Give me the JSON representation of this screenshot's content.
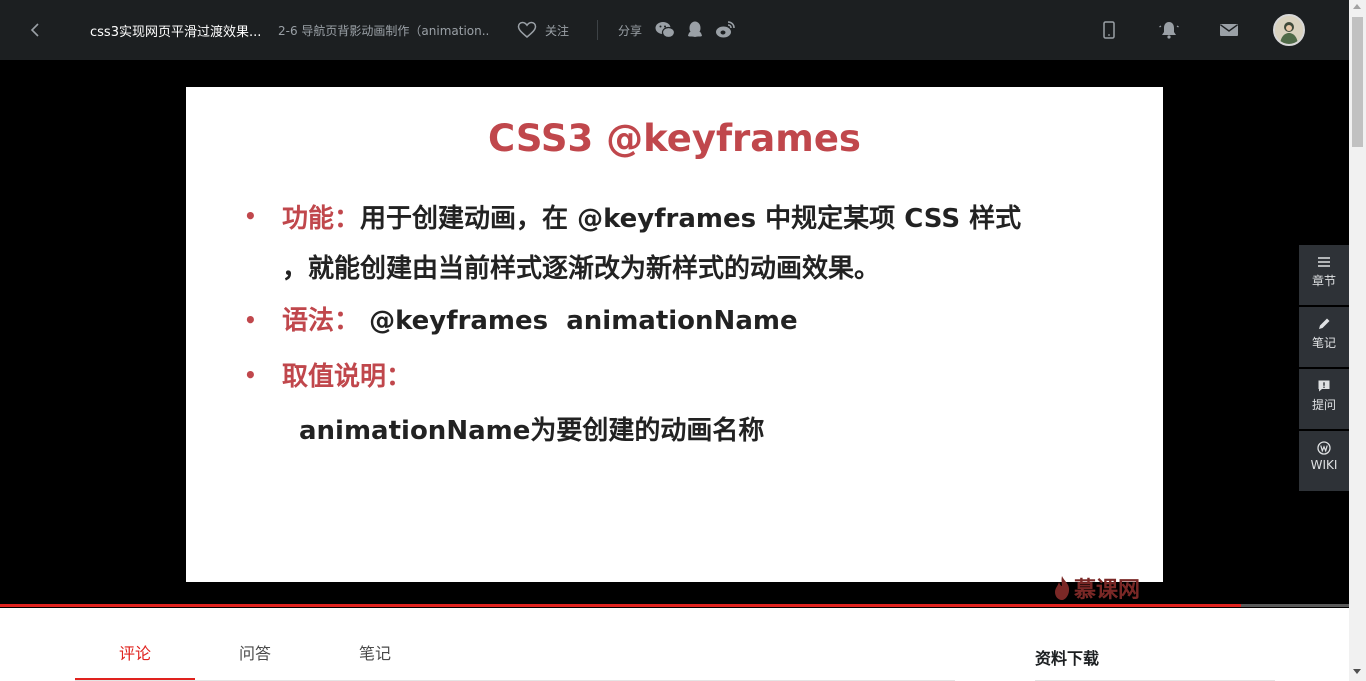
{
  "header": {
    "course_title": "css3实现网页平滑过渡效果...",
    "lesson_title": "2-6 导航页背影动画制作（animation...",
    "follow_label": "关注",
    "share_label": "分享",
    "share_icons": [
      "wechat-icon",
      "qq-icon",
      "weibo-icon"
    ],
    "right_icons": [
      "mobile-icon",
      "notification-bell-icon",
      "mail-icon"
    ]
  },
  "slide": {
    "title": "CSS3 @keyframes",
    "bullet_symbol": "•",
    "item1_label": "功能：",
    "item1_text": "用于创建动画，在 @keyframes 中规定某项 CSS 样式",
    "item1_cont": "，就能创建由当前样式逐渐改为新样式的动画效果。",
    "item2_label": "语法：",
    "item2_text": "@keyframes  animationName",
    "item3_label": "取值说明：",
    "item3_text": "animationName为要创建的动画名称"
  },
  "watermark": "慕课网",
  "playback_progress": 0.92,
  "side_tools": {
    "chapters": "章节",
    "notes": "笔记",
    "questions": "提问",
    "wiki": "WIKI"
  },
  "tabs": {
    "comments": "评论",
    "qa": "问答",
    "notes": "笔记",
    "active": "comments"
  },
  "downloads": {
    "title": "资料下载"
  },
  "colors": {
    "accent": "#e0221e",
    "slide_red": "#c0474c",
    "topbar_bg": "#1c1f21"
  }
}
